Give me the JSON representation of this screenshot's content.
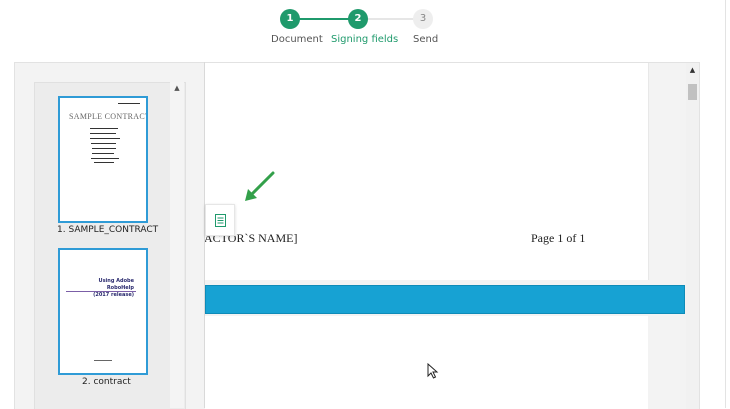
{
  "stepper": {
    "steps": [
      {
        "number": "1",
        "label": "Document"
      },
      {
        "number": "2",
        "label": "Signing fields"
      },
      {
        "number": "3",
        "label": "Send"
      }
    ]
  },
  "document": {
    "footer_name": "ACTOR`S  NAME]",
    "footer_page": "Page 1 of 1"
  },
  "thumbnails": [
    {
      "label": "1. SAMPLE_CONTRACT",
      "heading": "SAMPLE CONTRACT"
    },
    {
      "label": "2. contract",
      "heading": "Using Adobe RoboHelp\n(2017 release)"
    }
  ],
  "colors": {
    "accent_green": "#1f9a6c",
    "blue_bar": "#17a2d3",
    "thumb_border": "#2f9bd6"
  },
  "icons": {
    "field_button": "document-icon",
    "arrow": "arrow-icon",
    "cursor": "mouse-cursor-icon"
  }
}
